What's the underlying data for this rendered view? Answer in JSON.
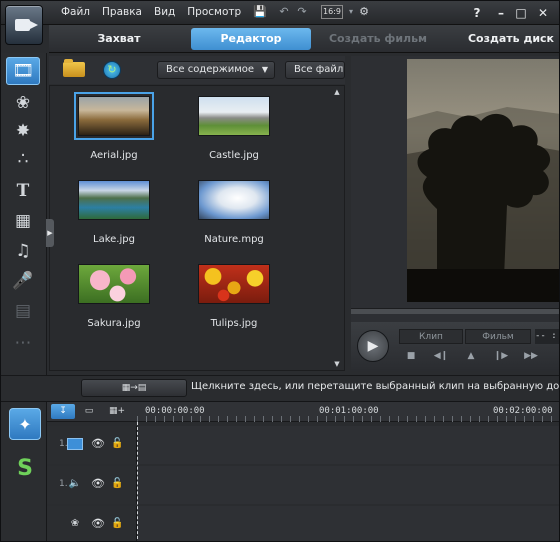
{
  "menu": {
    "items": [
      "Файл",
      "Правка",
      "Вид",
      "Просмотр"
    ],
    "aspect_label": "16:9"
  },
  "modes": {
    "capture": "Захват",
    "editor": "Редактор",
    "create_movie": "Создать фильм",
    "create_disc": "Создать диск"
  },
  "library": {
    "filter_content": "Все содержимое",
    "filter_files": "Все файлы",
    "items": [
      {
        "name": "Aerial.jpg",
        "icon": "landscape-thumb"
      },
      {
        "name": "Castle.jpg",
        "icon": "castle-thumb"
      },
      {
        "name": "Lake.jpg",
        "icon": "lake-thumb"
      },
      {
        "name": "Nature.mpg",
        "icon": "clouds-thumb"
      },
      {
        "name": "Sakura.jpg",
        "icon": "blossom-thumb"
      },
      {
        "name": "Tulips.jpg",
        "icon": "tulips-thumb"
      }
    ]
  },
  "player": {
    "clip_label": "Клип",
    "movie_label": "Фильм",
    "timecode": "-- : --"
  },
  "hint": {
    "text": "Щелкните здесь, или перетащите выбранный клип на выбранную дорожку."
  },
  "timeline": {
    "ruler": [
      "00:00:00:00",
      "00:01:00:00",
      "00:02:00:00"
    ],
    "tracks": [
      {
        "number": "1.",
        "type": "video-track-icon"
      },
      {
        "number": "1.",
        "type": "audio-track-icon"
      },
      {
        "number": "",
        "type": "effects-track-icon"
      }
    ]
  },
  "colors": {
    "accent": "#4a9fe3",
    "panel": "#2b2d30"
  }
}
